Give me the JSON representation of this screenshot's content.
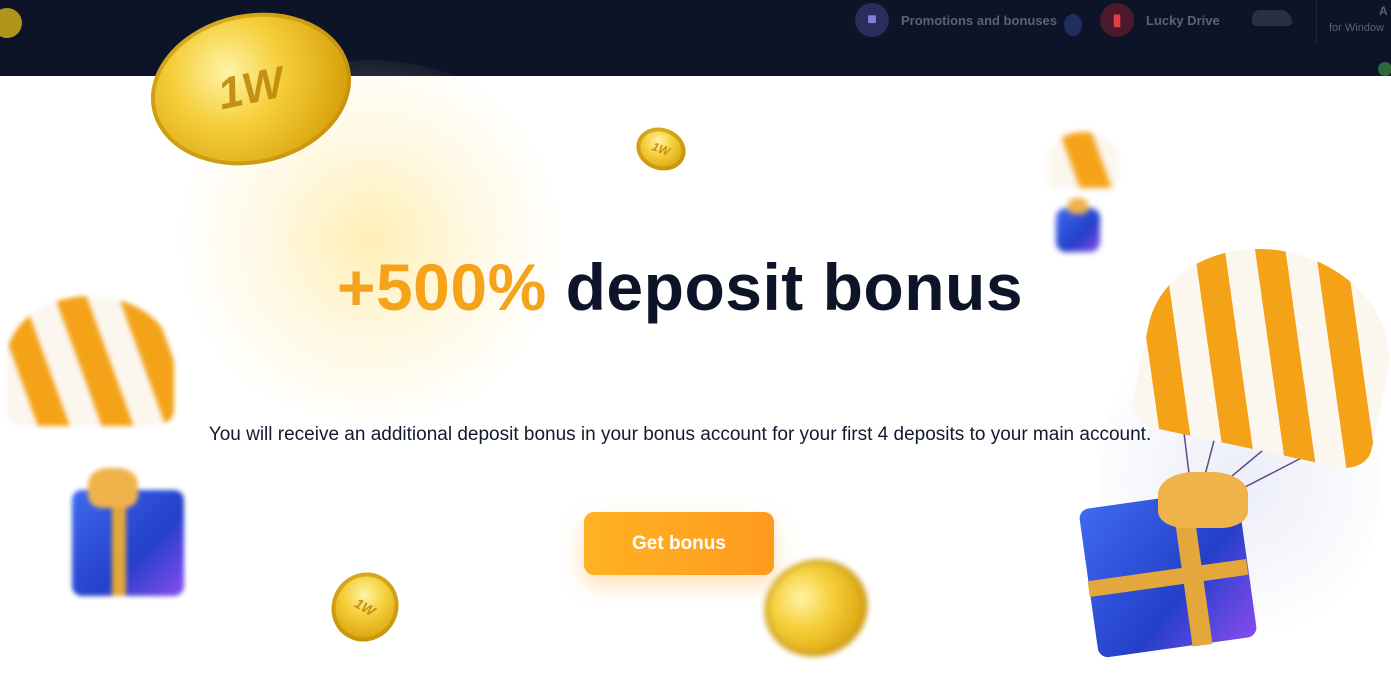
{
  "header": {
    "nav_items": [
      {
        "label": "Promotions and bonuses",
        "icon": "gift-icon"
      },
      {
        "label": "Lucky Drive",
        "icon": "lucky-drive-icon"
      }
    ],
    "windows_app": {
      "line1": "A",
      "line2": "for Window"
    }
  },
  "coin_logo_text": "1W",
  "hero": {
    "title_accent": "+500%",
    "title_rest": " deposit bonus",
    "subtitle": "You will receive an additional deposit bonus in your bonus account for your first 4 deposits to your main account.",
    "cta_label": "Get bonus"
  },
  "colors": {
    "accent": "#f5a31a",
    "header_bg": "#0d1427",
    "button": "#ffa21e",
    "text_dark": "#0d1427"
  }
}
